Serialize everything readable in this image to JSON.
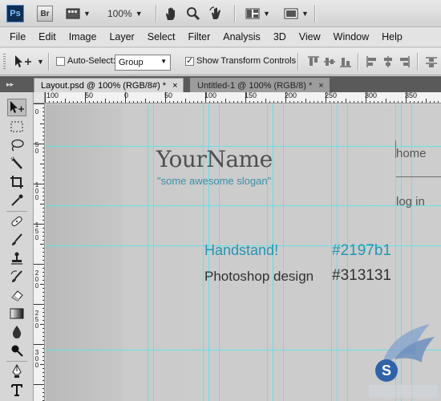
{
  "appbar": {
    "ps_logo": "Ps",
    "br_logo": "Br",
    "zoom": "100%",
    "icons": [
      "camera-raw-icon",
      "hand-icon",
      "zoom-icon",
      "rotate-icon",
      "arrange-icon",
      "screen-mode-icon"
    ]
  },
  "menu": [
    "File",
    "Edit",
    "Image",
    "Layer",
    "Select",
    "Filter",
    "Analysis",
    "3D",
    "View",
    "Window",
    "Help"
  ],
  "options": {
    "auto_select_label": "Auto-Select:",
    "auto_select_value": "Group",
    "show_transform_label": "Show Transform Controls",
    "auto_select_checked": false,
    "show_transform_checked": true
  },
  "tabs": [
    {
      "label": "Layout.psd @ 100% (RGB/8#) *",
      "close": "×",
      "active": true
    },
    {
      "label": "Untitled-1 @ 100% (RGB/8) *",
      "close": "×",
      "active": false
    }
  ],
  "ruler_h": [
    "100",
    "50",
    "0",
    "50",
    "100",
    "150",
    "200",
    "250",
    "300",
    "350"
  ],
  "ruler_v": [
    "0",
    "5",
    "0",
    "1",
    "0",
    "0",
    "1",
    "5",
    "0",
    "2",
    "0",
    "0",
    "2",
    "5",
    "0",
    "3",
    "0",
    "0"
  ],
  "canvas": {
    "logo": "YourName",
    "slogan": "\"some awesome slogan\"",
    "nav_home": "home",
    "nav_login": "log in",
    "handstand": "Handstand!",
    "color_blue": "#2197b1",
    "photoshop": "Photoshop design",
    "color_dark": "#313131"
  },
  "colors": {
    "guide": "#59e3ec",
    "slogan": "#3c8ea6",
    "accent": "#2197b1",
    "dark": "#313131"
  }
}
